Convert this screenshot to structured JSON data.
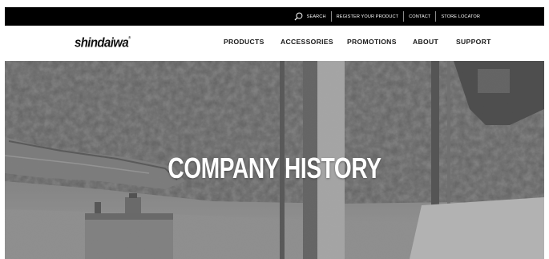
{
  "utility_bar": {
    "search_label": "SEARCH",
    "links": [
      "REGISTER YOUR PRODUCT",
      "CONTACT",
      "STORE LOCATOR"
    ]
  },
  "brand": {
    "logo_text": "shindaiwa",
    "logo_mark": "®"
  },
  "main_nav": {
    "items": [
      "PRODUCTS",
      "ACCESSORIES",
      "PROMOTIONS",
      "ABOUT",
      "SUPPORT"
    ]
  },
  "hero": {
    "title": "COMPANY HISTORY"
  },
  "colors": {
    "utility_bar_bg": "#000000",
    "nav_bg": "#ffffff",
    "nav_text": "#1a1a1a",
    "hero_title": "#ffffff"
  },
  "icons": {
    "search": "search-icon"
  }
}
